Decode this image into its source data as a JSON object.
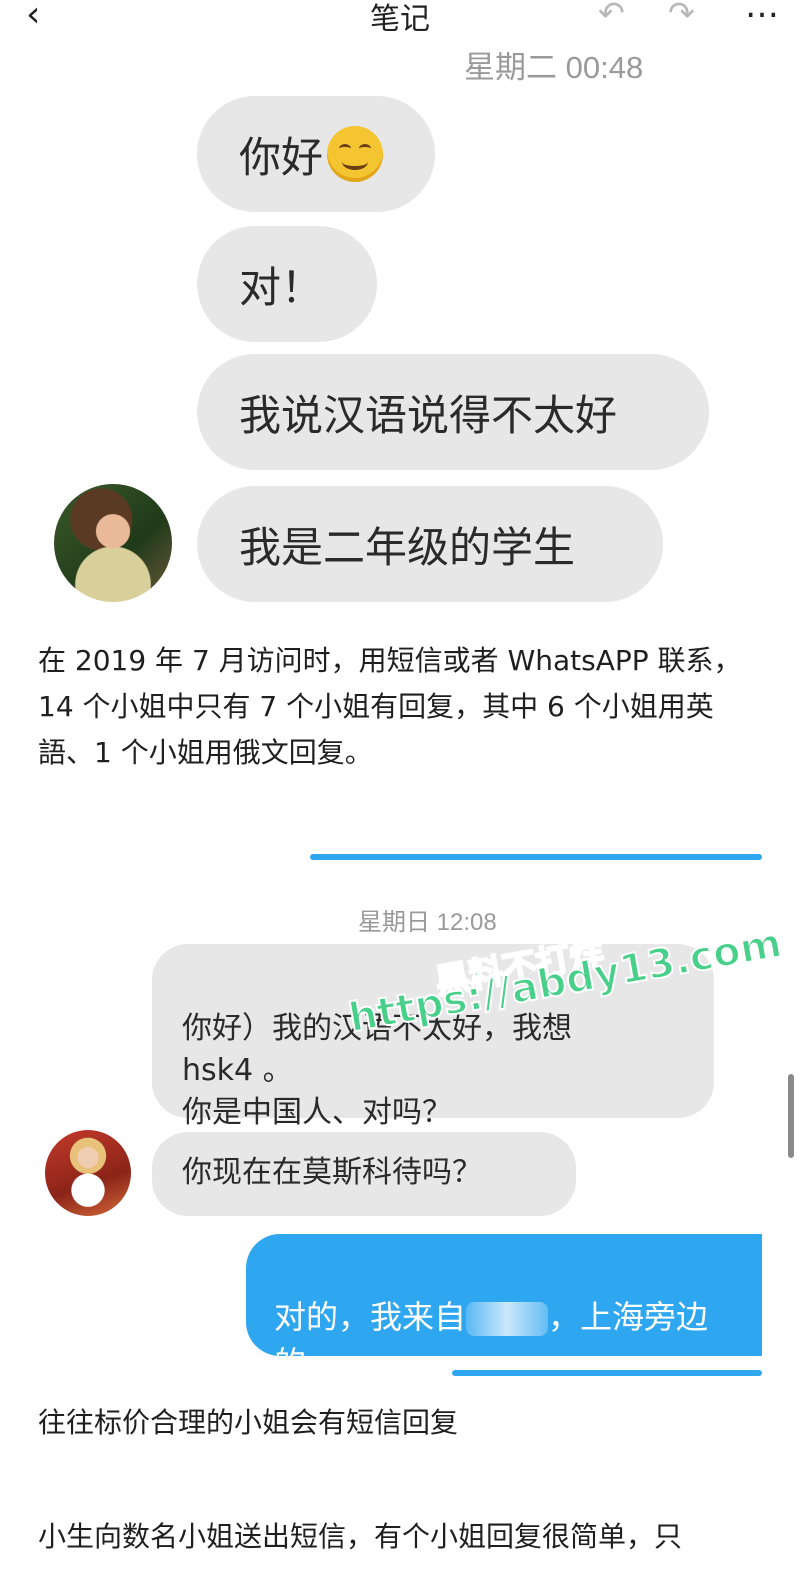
{
  "header": {
    "back_icon": "‹",
    "title": "笔记",
    "undo_icon": "↶",
    "redo_icon": "↷",
    "more_icon": "…"
  },
  "chat1": {
    "timestamp": "星期二 00:48",
    "messages": [
      "你好",
      "对！",
      "我说汉语说得不太好",
      "我是二年级的学生"
    ]
  },
  "paragraph1": "在 2019 年 7 月访问时，用短信或者 WhatsAPP 联系，14 个小姐中只有 7 个小姐有回复，其中 6 个小姐用英語、1 个小姐用俄文回复。",
  "chat2": {
    "timestamp": "星期日 12:08",
    "incoming": [
      "你好）我的汉语不太好，我想\nhsk4 。\n你是中国人、对吗？",
      "你现在在莫斯科待吗？"
    ],
    "outgoing_before_blur": "对的，我来自",
    "outgoing_after_blur": "，上海旁边的\n城市。我刚刚搬来莫斯科住。"
  },
  "paragraph2": "往往标价合理的小姐会有短信回复",
  "paragraph3": "小生向数名小姐送出短信，有个小姐回复很简单，只",
  "watermark": {
    "line1": "黑料不打烊",
    "line2": "https://abdy13.com"
  },
  "colors": {
    "bubble_gray": "#e7e7e7",
    "bubble_blue": "#2fa7f0",
    "watermark_green": "#48d08a"
  }
}
